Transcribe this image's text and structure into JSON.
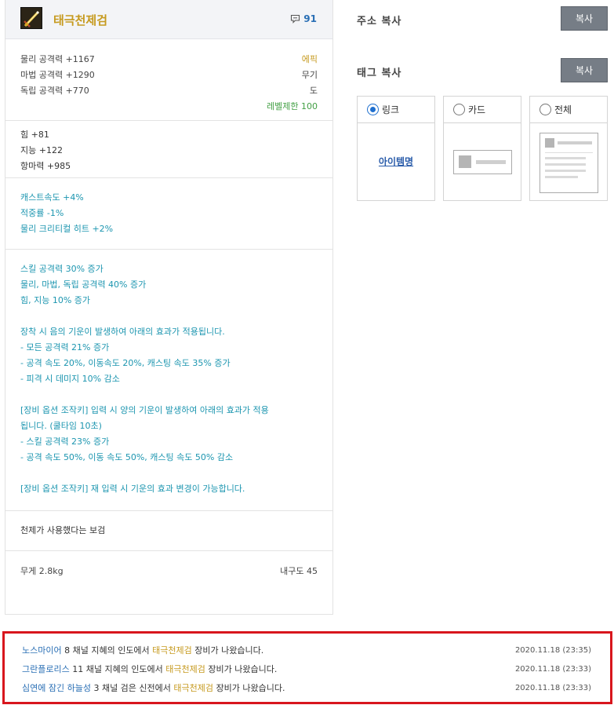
{
  "item": {
    "name": "태극천제검",
    "icon": "sword-icon",
    "comment_count": "91",
    "base_stats": [
      {
        "label": "물리 공격력 +1167",
        "right": "에픽",
        "right_color": "#c69a1f"
      },
      {
        "label": "마법 공격력 +1290",
        "right": "무기",
        "right_color": "#444444"
      },
      {
        "label": "독립 공격력 +770",
        "right": "도",
        "right_color": "#444444"
      },
      {
        "label": "",
        "right": "레벨제한 100",
        "right_color": "#43a045"
      }
    ],
    "stats": [
      "힘 +81",
      "지능 +122",
      "항마력 +985"
    ],
    "options": [
      "캐스트속도 +4%",
      "적중률 -1%",
      "물리 크리티컬 히트 +2%"
    ],
    "effects": [
      "스킬 공격력 30% 증가",
      "물리, 마법, 독립 공격력 40% 증가",
      "힘, 지능 10% 증가",
      "",
      "장착 시 음의 기운이 발생하여 아래의 효과가 적용됩니다.",
      "- 모든 공격력 21% 증가",
      "- 공격 속도 20%, 이동속도 20%, 캐스팅 속도 35% 증가",
      "- 피격 시 데미지 10% 감소",
      "",
      "[장비 옵션 조작키] 입력 시 양의 기운이 발생하여 아래의 효과가 적용",
      "됩니다. (쿨타임 10초)",
      "- 스킬 공격력 23% 증가",
      "- 공격 속도 50%, 이동 속도 50%, 캐스팅 속도 50% 감소",
      "",
      "[장비 옵션 조작키] 재 입력 시 기운의 효과 변경이 가능합니다."
    ],
    "flavor": "천제가 사용했다는 보검",
    "weight": "무게 2.8kg",
    "durability": "내구도 45"
  },
  "copy": {
    "address_label": "주소 복사",
    "tag_label": "태그 복사",
    "button_label": "복사",
    "tabs": [
      {
        "label": "링크",
        "selected": true
      },
      {
        "label": "카드",
        "selected": false
      },
      {
        "label": "전체",
        "selected": false
      }
    ],
    "link_preview": "아이템명"
  },
  "drops": [
    {
      "who": "노스마이어",
      "pre": " 8 채널 지혜의 인도에서 ",
      "item": "태극천제검",
      "post": " 장비가 나왔습니다.",
      "time": "2020.11.18 (23:35)"
    },
    {
      "who": "그란플로리스",
      "pre": " 11 채널 지혜의 인도에서 ",
      "item": "태극천제검",
      "post": " 장비가 나왔습니다.",
      "time": "2020.11.18 (23:33)"
    },
    {
      "who": "심연에 잠긴 하늘성",
      "pre": " 3 채널 검은 신전에서 ",
      "item": "태극천제검",
      "post": " 장비가 나왔습니다.",
      "time": "2020.11.18 (23:33)"
    }
  ],
  "colors": {
    "accent": "#c69a1f",
    "link": "#2a6fb5",
    "effect": "#1d96b0",
    "highlight_border": "#d8161d"
  }
}
